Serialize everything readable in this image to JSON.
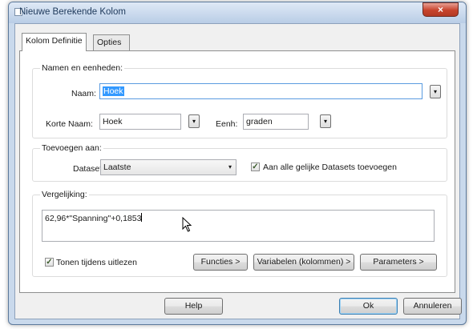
{
  "window": {
    "title": "Nieuwe Berekende Kolom",
    "close_symbol": "×"
  },
  "tabs": [
    {
      "label": "Kolom Definitie",
      "active": true
    },
    {
      "label": "Opties",
      "active": false
    }
  ],
  "names_group": {
    "legend": "Namen en eenheden:",
    "name_label": "Naam:",
    "name_value": "Hoek",
    "short_name_label": "Korte Naam:",
    "short_name_value": "Hoek",
    "unit_label": "Eenh:",
    "unit_value": "graden"
  },
  "add_group": {
    "legend": "Toevoegen aan:",
    "dataset_label": "Dataset:",
    "dataset_value": "Laatste",
    "add_all_label": "Aan alle gelijke Datasets toevoegen",
    "add_all_checked": true
  },
  "equation_group": {
    "legend": "Vergelijking:",
    "equation": "62,96*\"Spanning\"+0,1853",
    "show_live_label": "Tonen tijdens uitlezen",
    "show_live_checked": true
  },
  "equation_buttons": {
    "functions": "Functies >",
    "variables": "Variabelen (kolommen) >",
    "parameters": "Parameters >"
  },
  "footer_buttons": {
    "help": "Help",
    "ok": "Ok",
    "cancel": "Annuleren"
  },
  "icons": {
    "dropdown": "▾",
    "check": "✓"
  }
}
